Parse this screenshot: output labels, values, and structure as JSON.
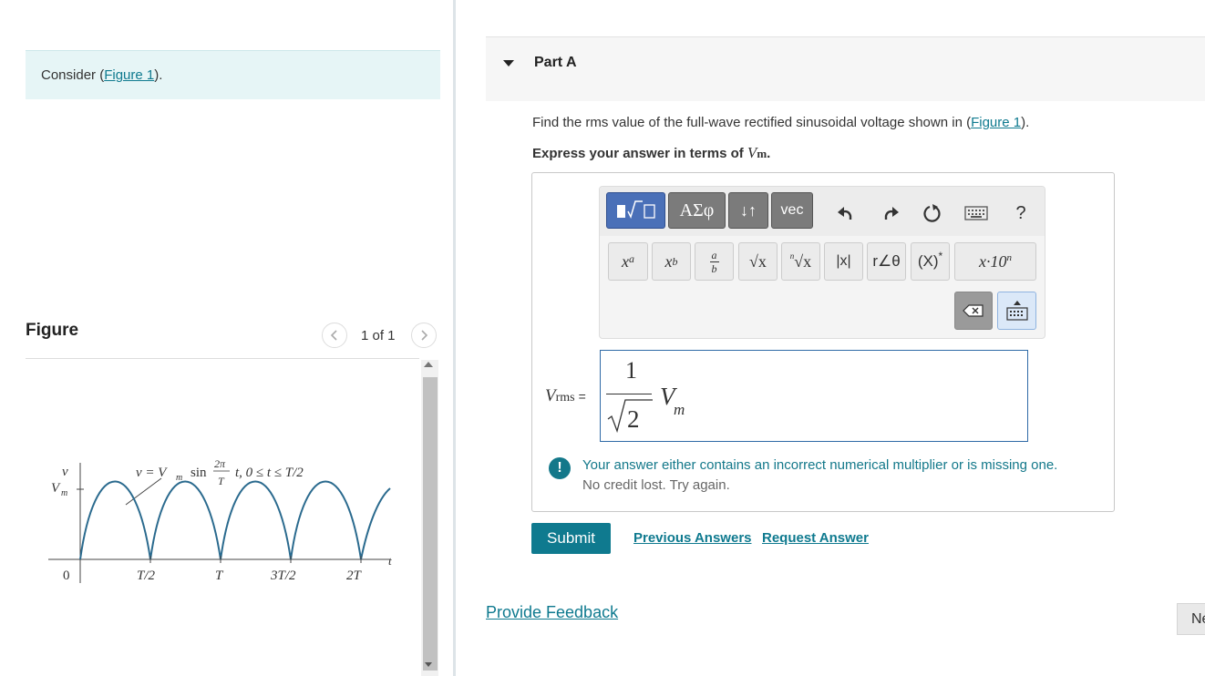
{
  "left": {
    "consider_prefix": "Consider (",
    "consider_link": "Figure 1",
    "consider_suffix": ").",
    "figure_title": "Figure",
    "figure_count": "1 of 1",
    "prev_icon": "chevron-left-icon",
    "next_icon": "chevron-right-icon"
  },
  "figure": {
    "y_label_v": "v",
    "y_label_vm": "V",
    "y_label_vm_sub": "m",
    "equation": {
      "lhs": "v = V",
      "sub": "m",
      "sin": "sin",
      "num": "2π",
      "den": "T",
      "rest": "t, 0 ≤ t ≤ T/2"
    },
    "x_ticks": [
      "0",
      "T/2",
      "T",
      "3T/2",
      "2T"
    ],
    "x_axis_label": "t",
    "curve_color": "#2a6a8e"
  },
  "part": {
    "title": "Part A",
    "question_prefix": "Find the rms value of the full-wave rectified sinusoidal voltage shown in (",
    "question_link": "Figure 1",
    "question_suffix": ").",
    "express_prefix": "Express your answer in terms of ",
    "express_var": "V",
    "express_sub": "m",
    "express_suffix": "."
  },
  "toolbar": {
    "greek": "ΑΣφ",
    "arrows": "↓↑",
    "vec": "vec",
    "help": "?",
    "icons": [
      "templates-icon",
      "undo-icon",
      "redo-icon",
      "reset-icon",
      "keyboard-icon"
    ],
    "keys": {
      "sup_base": "x",
      "sup_exp": "a",
      "sub_base": "x",
      "sub_idx": "b",
      "frac_num": "a",
      "frac_den": "b",
      "sqrt": "√x",
      "nroot_n": "n",
      "nroot": "√x",
      "abs": "|x|",
      "polar": "r∠θ",
      "conj": "(X)",
      "conj_star": "*",
      "sci_base": "x·10",
      "sci_exp": "n"
    }
  },
  "answer": {
    "label_var": "V",
    "label_sub": "rms",
    "label_eq": "=",
    "numerator": "1",
    "denominator": "2",
    "var": "V",
    "var_sub": "m"
  },
  "feedback": {
    "icon": "exclamation-icon",
    "line1": "Your answer either contains an incorrect numerical multiplier or is missing one.",
    "line2": "No credit lost. Try again.",
    "color": "#13788a"
  },
  "actions": {
    "submit": "Submit",
    "previous_answers": "Previous Answers",
    "request_answer": "Request Answer",
    "provide_feedback": "Provide Feedback",
    "next": "Ne"
  },
  "colors": {
    "accent": "#0f7a8f",
    "consider_bg": "#e6f5f6",
    "template_btn": "#4a70b8"
  }
}
